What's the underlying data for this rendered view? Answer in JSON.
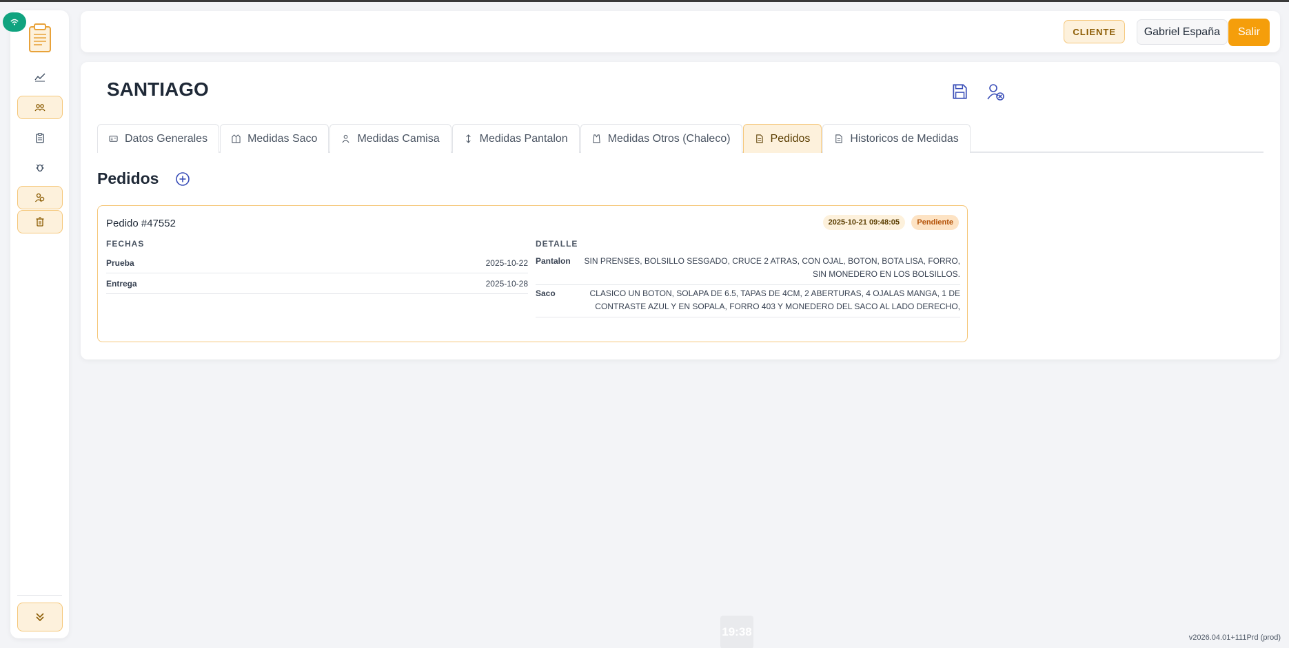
{
  "sidebar": {
    "items": [
      {
        "icon": "chart-line-icon"
      },
      {
        "icon": "team-icon"
      },
      {
        "icon": "clipboard-icon"
      },
      {
        "icon": "bug-icon"
      },
      {
        "icon": "users-icon"
      },
      {
        "icon": "trash-icon"
      }
    ]
  },
  "topbar": {
    "role": "CLIENTE",
    "user": "Gabriel España",
    "logout": "Salir"
  },
  "client": {
    "name": "SANTIAGO"
  },
  "tabs": [
    {
      "label": "Datos Generales",
      "icon": "id-card-icon"
    },
    {
      "label": "Medidas Saco",
      "icon": "jacket-icon"
    },
    {
      "label": "Medidas Camisa",
      "icon": "person-icon"
    },
    {
      "label": "Medidas Pantalon",
      "icon": "vertical-arrows-icon"
    },
    {
      "label": "Medidas Otros (Chaleco)",
      "icon": "vest-icon"
    },
    {
      "label": "Pedidos",
      "icon": "document-icon",
      "active": true
    },
    {
      "label": "Historicos de Medidas",
      "icon": "document-icon"
    }
  ],
  "section": {
    "title": "Pedidos"
  },
  "order": {
    "title": "Pedido #47552",
    "date": "2025-10-21 09:48:05",
    "status": "Pendiente",
    "fechas_header": "FECHAS",
    "detalle_header": "DETALLE",
    "fechas": [
      {
        "label": "Prueba",
        "value": "2025-10-22"
      },
      {
        "label": "Entrega",
        "value": "2025-10-28"
      }
    ],
    "detalle": [
      {
        "label": "Pantalon",
        "value": "SIN PRENSES, BOLSILLO SESGADO, CRUCE 2 ATRAS, CON OJAL, BOTON, BOTA LISA, FORRO, SIN MONEDERO EN LOS BOLSILLOS."
      },
      {
        "label": "Saco",
        "value": "CLASICO UN BOTON, SOLAPA DE 6.5, TAPAS DE 4CM, 2 ABERTURAS, 4 OJALAS MANGA, 1 DE CONTRASTE AZUL Y EN SOPALA, FORRO 403 Y MONEDERO DEL SACO AL LADO DERECHO,"
      }
    ]
  },
  "footer": {
    "clock": "19:38",
    "version": "v2026.04.01+111Prd (prod)"
  },
  "colors": {
    "accent": "#f59e0b",
    "accent_soft": "#fdf1dc",
    "icon_blue": "#3b4fb8",
    "status_green": "#10a37f"
  }
}
